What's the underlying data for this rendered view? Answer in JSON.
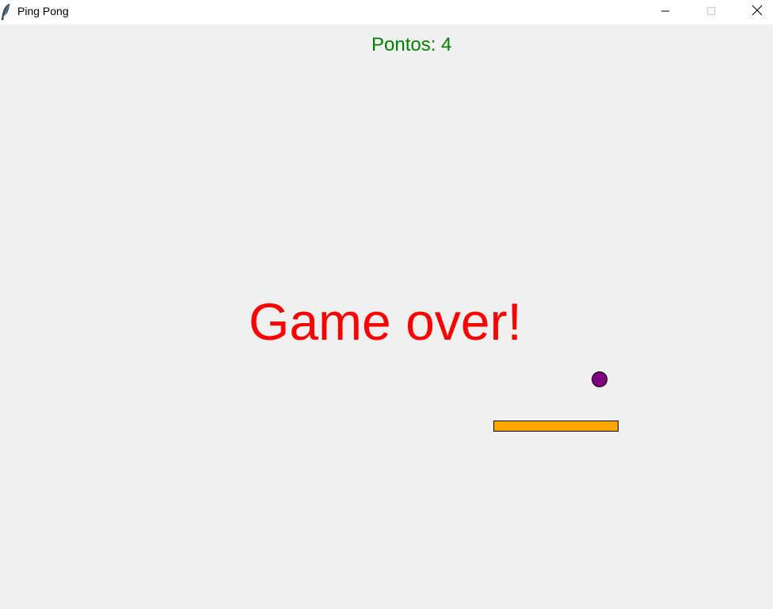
{
  "window": {
    "title": "Ping Pong",
    "app_icon": "feather-icon",
    "controls": {
      "minimize_icon": "minimize-icon",
      "maximize_icon": "maximize-icon",
      "close_icon": "close-icon"
    }
  },
  "game": {
    "score_text": "Pontos: 4",
    "game_over_text": "Game over!",
    "colors": {
      "background": "#f0f0f0",
      "score": "#008000",
      "game_over": "#ff0000",
      "ball": "#800080",
      "paddle": "#ffa500"
    }
  }
}
